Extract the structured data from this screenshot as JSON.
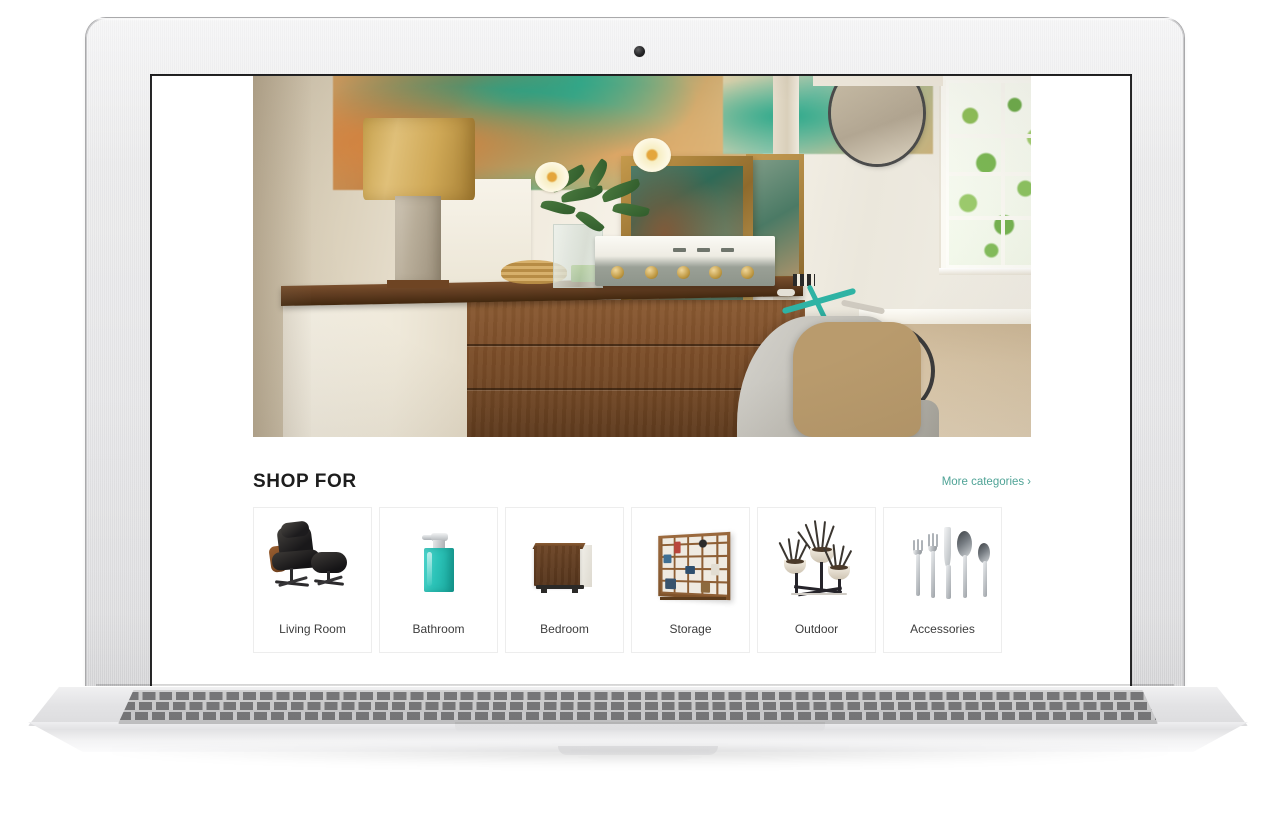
{
  "device": {
    "type": "laptop-mockup",
    "components": {
      "webcam": "webcam-dot",
      "screen": "screen-viewport",
      "keyboard": "keyboard-deck",
      "trackpad": "trackpad"
    }
  },
  "page": {
    "hero": {
      "name": "hero-banner",
      "description": "Styled interior room photo: brass table lamp, flowers in glass vase, vintage stereo amplifier on a walnut dresser, framed artwork, round mirror, bright window, grey chair with plaid shirt and a teal bicycle."
    },
    "shop": {
      "title": "SHOP FOR",
      "more_link": {
        "label": "More categories",
        "chevron": "›",
        "color": "#4fa396"
      },
      "categories": [
        {
          "label": "Living Room",
          "icon": "lounge-chair-icon"
        },
        {
          "label": "Bathroom",
          "icon": "soap-dispenser-icon"
        },
        {
          "label": "Bedroom",
          "icon": "nightstand-icon"
        },
        {
          "label": "Storage",
          "icon": "shelving-unit-icon"
        },
        {
          "label": "Outdoor",
          "icon": "potted-plants-icon"
        },
        {
          "label": "Accessories",
          "icon": "flatware-icon"
        }
      ]
    }
  },
  "theme": {
    "background": "#ffffff",
    "text": "#1d1d1d",
    "muted_text": "#3c3c3c",
    "accent": "#4fa396",
    "tile_border": "#ededed"
  }
}
